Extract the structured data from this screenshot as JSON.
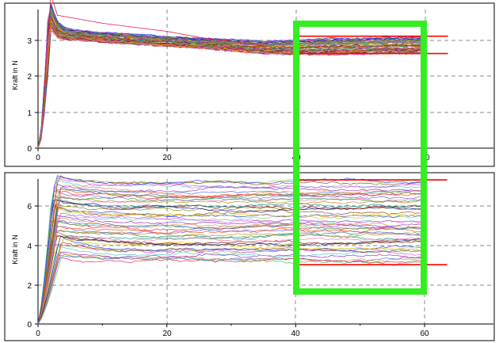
{
  "chart_data": [
    {
      "type": "line",
      "title": "",
      "xlabel": "",
      "ylabel": "Kraft in N",
      "xlim": [
        0,
        65
      ],
      "ylim": [
        0,
        3.6
      ],
      "x_ticks": [
        "0",
        "20",
        "40",
        "60"
      ],
      "y_ticks": [
        "0",
        "1",
        "2",
        "3"
      ],
      "grid": true,
      "series_count": 60,
      "bundle": {
        "x": [
          0,
          0.5,
          1,
          1.5,
          2,
          2.5,
          3,
          4,
          6,
          10,
          15,
          20,
          25,
          30,
          35,
          40,
          45,
          50,
          55,
          60
        ],
        "center": [
          0,
          0.4,
          1.3,
          2.6,
          3.25,
          3.1,
          2.95,
          2.85,
          2.8,
          2.75,
          2.7,
          2.65,
          2.6,
          2.55,
          2.5,
          2.5,
          2.52,
          2.53,
          2.55,
          2.55
        ],
        "spread": [
          0,
          0.15,
          0.3,
          0.3,
          0.35,
          0.25,
          0.2,
          0.15,
          0.12,
          0.12,
          0.12,
          0.12,
          0.12,
          0.14,
          0.15,
          0.18,
          0.2,
          0.2,
          0.2,
          0.2
        ],
        "outlier": {
          "x": [
            1,
            2,
            3,
            10,
            20,
            25,
            30,
            35
          ],
          "y": [
            1.5,
            3.8,
            3.3,
            3.1,
            2.9,
            2.75,
            2.65,
            2.55
          ]
        }
      },
      "reference_lines": [
        {
          "y": 2.78,
          "x_range": [
            40,
            63.5
          ],
          "color": "#ff0000"
        },
        {
          "y": 2.35,
          "x_range": [
            40,
            63.5
          ],
          "color": "#ff0000"
        }
      ]
    },
    {
      "type": "line",
      "title": "",
      "xlabel": "",
      "ylabel": "Kraft in N",
      "xlim": [
        0,
        68
      ],
      "ylim": [
        0,
        7.4
      ],
      "x_ticks": [
        "0",
        "20",
        "40",
        "60"
      ],
      "y_ticks": [
        "0",
        "2",
        "4",
        "6"
      ],
      "grid": true,
      "series_count": 50,
      "bundle": {
        "x": [
          0,
          0.5,
          1,
          1.5,
          2,
          2.5,
          3,
          4,
          6,
          10,
          15,
          20,
          25,
          30,
          35,
          40,
          45,
          50,
          55,
          60
        ],
        "level_range": [
          3.0,
          7.0
        ],
        "rise_end_x": 3.5
      },
      "reference_lines": [
        {
          "y": 7.05,
          "x_range": [
            40,
            63.5
          ],
          "color": "#ff0000"
        },
        {
          "y": 2.9,
          "x_range": [
            40,
            63.5
          ],
          "color": "#ff0000"
        }
      ]
    }
  ],
  "highlight_box": {
    "x_range": [
      40,
      60
    ],
    "color": "#33ee22"
  },
  "colors": {
    "palette": [
      "#e6194b",
      "#3cb44b",
      "#4363d8",
      "#f58231",
      "#911eb4",
      "#46c0c8",
      "#f032e6",
      "#9acd32",
      "#8b4513",
      "#1e3cff",
      "#ffbf00",
      "#808000",
      "#000080",
      "#800000",
      "#008080",
      "#ff69b4",
      "#2e8b57",
      "#b8860b",
      "#6a5acd",
      "#ff4500"
    ],
    "reference": "#ff0000",
    "highlight": "#33ee22",
    "grid": "#888888"
  }
}
